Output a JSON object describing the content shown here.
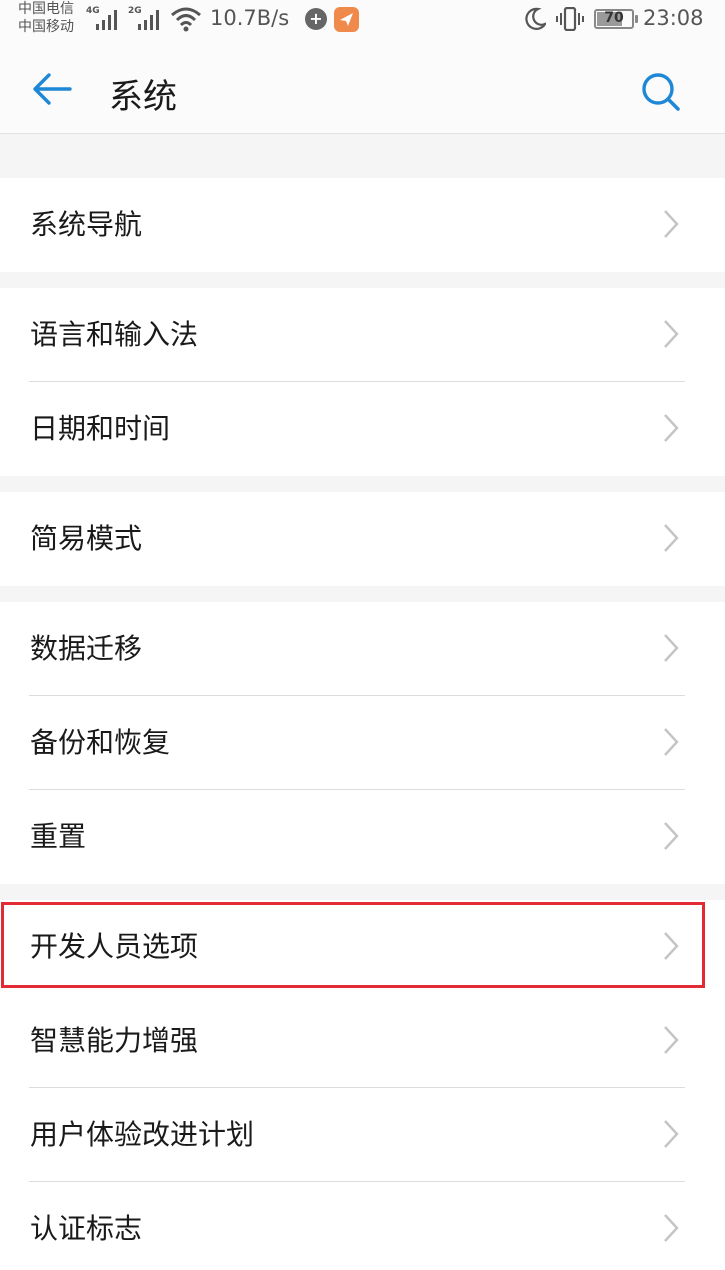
{
  "status_bar": {
    "carrier_1": "中国电信",
    "carrier_2": "中国移动",
    "signal_1_tag": "4G",
    "signal_2_tag": "2G",
    "net_speed": "10.7B/s",
    "battery_level": "70",
    "time": "23:08",
    "icons": [
      "wifi-icon",
      "message-icon",
      "app-notification-icon",
      "moon-icon",
      "vibrate-icon",
      "battery-icon"
    ]
  },
  "header": {
    "title": "系统",
    "back_icon": "arrow-left-icon",
    "search_icon": "search-icon",
    "accent_color": "#1e88d6"
  },
  "groups": [
    {
      "items": [
        {
          "label": "系统导航"
        }
      ]
    },
    {
      "items": [
        {
          "label": "语言和输入法"
        },
        {
          "label": "日期和时间"
        }
      ]
    },
    {
      "items": [
        {
          "label": "简易模式"
        }
      ]
    },
    {
      "items": [
        {
          "label": "数据迁移"
        },
        {
          "label": "备份和恢复"
        },
        {
          "label": "重置"
        }
      ]
    },
    {
      "items": [
        {
          "label": "开发人员选项",
          "highlighted": true
        },
        {
          "label": "智慧能力增强"
        },
        {
          "label": "用户体验改进计划"
        },
        {
          "label": "认证标志"
        }
      ]
    }
  ],
  "highlight_color": "#e32b35"
}
